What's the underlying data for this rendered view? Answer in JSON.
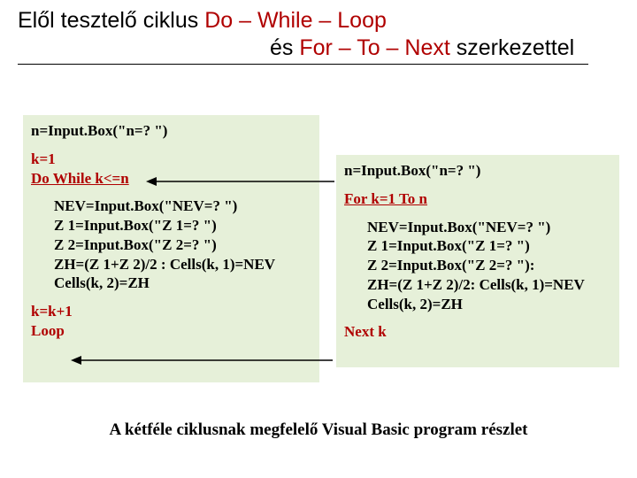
{
  "title": {
    "line1_black": "Elől tesztelő ciklus ",
    "line1_red": "Do – While – Loop",
    "line2_black": "és  ",
    "line2_red": "For – To – Next ",
    "line2_black2": "szerkezettel"
  },
  "left": {
    "l1": "n=Input.Box(\"n=? \")",
    "l2": "k=1",
    "l3": "Do  While k<=n",
    "b1": "NEV=Input.Box(\"NEV=? \")",
    "b2": "Z 1=Input.Box(\"Z 1=? \")",
    "b3": "Z 2=Input.Box(\"Z 2=? \")",
    "b4": "ZH=(Z 1+Z 2)/2 : Cells(k, 1)=NEV",
    "b5": "Cells(k, 2)=ZH",
    "l4a": " k=k+1",
    "l4b": "Loop"
  },
  "right": {
    "l1": "n=Input.Box(\"n=? \")",
    "l2": "For  k=1  To  n",
    "b1": "NEV=Input.Box(\"NEV=? \")",
    "b2": "Z 1=Input.Box(\"Z 1=? \")",
    "b3": "Z 2=Input.Box(\"Z 2=? \"):",
    "b4": "ZH=(Z 1+Z 2)/2:   Cells(k, 1)=NEV",
    "b5": "Cells(k, 2)=ZH",
    "l3": "Next k"
  },
  "caption": "A kétféle ciklusnak megfelelő Visual Basic program részlet"
}
